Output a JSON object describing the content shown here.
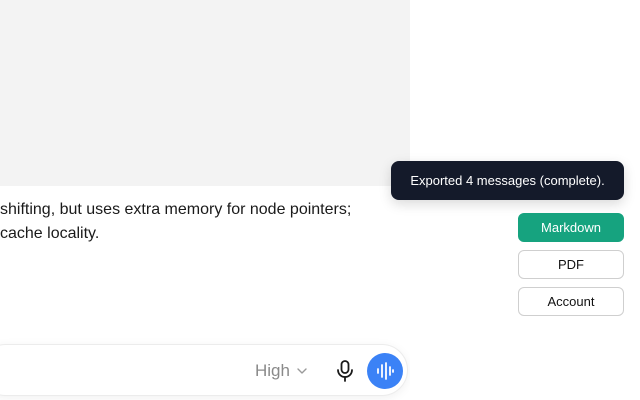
{
  "chat": {
    "message_lines": [
      "shifting, but uses extra memory for node pointers;",
      "cache locality."
    ]
  },
  "composer": {
    "reasoning_level": "High",
    "reasoning_icon": "chevron-down-icon",
    "mic_icon": "microphone-icon",
    "voice_icon": "voice-waveform-icon",
    "voice_color": "#3b82f6"
  },
  "toast": {
    "text": "Exported 4 messages (complete)."
  },
  "export_menu": {
    "markdown_label": "Markdown",
    "pdf_label": "PDF",
    "account_label": "Account",
    "accent_color": "#16a37f"
  }
}
